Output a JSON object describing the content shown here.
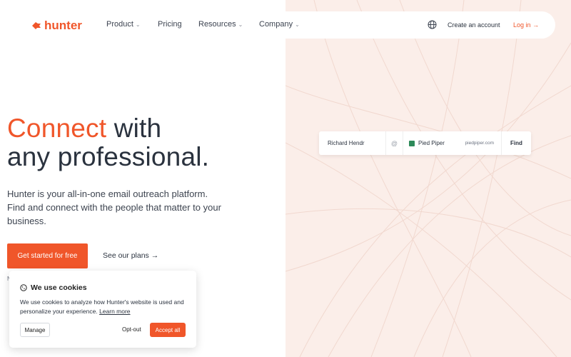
{
  "nav": {
    "brand": "hunter",
    "items": [
      {
        "label": "Product",
        "has_dropdown": true
      },
      {
        "label": "Pricing",
        "has_dropdown": false
      },
      {
        "label": "Resources",
        "has_dropdown": true
      },
      {
        "label": "Company",
        "has_dropdown": true
      }
    ],
    "create_account": "Create an account",
    "login": "Log in →",
    "globe_icon": "globe-icon"
  },
  "hero": {
    "title_accent": "Connect",
    "title_rest_line1": " with",
    "title_line2": "any professional.",
    "subtitle": "Hunter is your all-in-one email outreach platform. Find and connect with the people that matter to your business.",
    "cta_primary": "Get started for free",
    "cta_secondary": "See our plans →",
    "trust_text": "N"
  },
  "search_widget": {
    "name": "Richard Hendr",
    "at": "@",
    "company": "Pied Piper",
    "domain": "piedpiper.com",
    "find": "Find"
  },
  "cookie_banner": {
    "title": "We use cookies",
    "body": "We use cookies to analyze how Hunter's website is used and personalize your experience.",
    "learn_more": "Learn more",
    "manage": "Manage",
    "opt_out": "Opt-out",
    "accept_all": "Accept all"
  },
  "colors": {
    "accent": "#f0562a",
    "right_panel_bg": "#fbeee9",
    "text_dark": "#2a323e"
  }
}
